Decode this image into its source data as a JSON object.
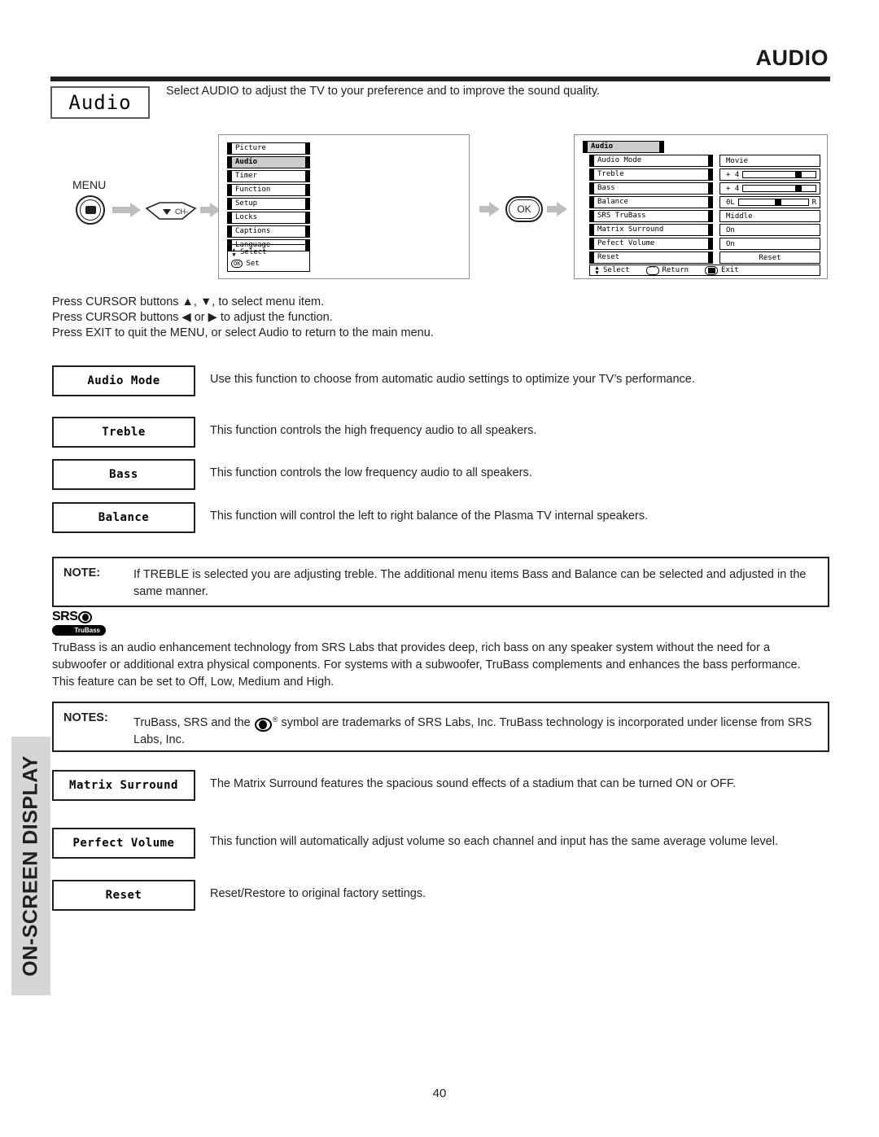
{
  "page": {
    "header_title": "AUDIO",
    "number": "40",
    "side_tab_label": "ON-SCREEN DISPLAY"
  },
  "intro": {
    "tag_label": "Audio",
    "description": "Select AUDIO to adjust the TV to your preference and to improve the sound quality."
  },
  "flow": {
    "menu_button_label": "MENU",
    "ch_button_label": "CH-",
    "ok_button_label": "OK"
  },
  "osd_main": {
    "items": [
      {
        "label": "Picture",
        "selected": false
      },
      {
        "label": "Audio",
        "selected": true
      },
      {
        "label": "Timer",
        "selected": false
      },
      {
        "label": "Function",
        "selected": false
      },
      {
        "label": "Setup",
        "selected": false
      },
      {
        "label": "Locks",
        "selected": false
      },
      {
        "label": "Captions",
        "selected": false
      },
      {
        "label": "Language",
        "selected": false
      }
    ],
    "hint_select": "Select",
    "hint_set": "Set",
    "hint_set_chip": "OK"
  },
  "osd_audio": {
    "title": "Audio",
    "rows": [
      {
        "label": "Audio Mode",
        "value": "Movie",
        "type": "text"
      },
      {
        "label": "Treble",
        "value": "+ 4",
        "type": "slider",
        "knob_percent": 72
      },
      {
        "label": "Bass",
        "value": "+ 4",
        "type": "slider",
        "knob_percent": 72
      },
      {
        "label": "Balance",
        "value": "0L",
        "type": "balance",
        "right_label": "R",
        "knob_percent": 52
      },
      {
        "label": "SRS TruBass",
        "value": "Middle",
        "type": "text"
      },
      {
        "label": "Matrix Surround",
        "value": "On",
        "type": "text"
      },
      {
        "label": "Pefect Volume",
        "value": "On",
        "type": "text"
      },
      {
        "label": "Reset",
        "value": "Reset",
        "type": "button"
      }
    ],
    "bottom_select": "Select",
    "bottom_return": "Return",
    "bottom_exit": "Exit"
  },
  "cursor_instructions": [
    "Press CURSOR buttons ▲, ▼, to select menu item.",
    "Press CURSOR buttons ◀ or ▶ to adjust the function.",
    "Press EXIT to quit the MENU, or select Audio to return to the main menu."
  ],
  "functions": [
    {
      "name": "Audio Mode",
      "description": "Use this function to choose from automatic audio settings to optimize your TV’s performance."
    },
    {
      "name": "Treble",
      "description": "This function controls the high frequency audio to all speakers."
    },
    {
      "name": "Bass",
      "description": "This function controls the low frequency audio to all speakers."
    },
    {
      "name": "Balance",
      "description": "This function will control the left to right balance of the Plasma TV internal speakers."
    },
    {
      "name": "Matrix Surround",
      "description": "The Matrix Surround features the spacious sound effects of a stadium that can be turned ON or OFF."
    },
    {
      "name": "Perfect Volume",
      "description": "This function will automatically adjust volume so each channel  and input has the same average volume level."
    },
    {
      "name": "Reset",
      "description": "Reset/Restore to original factory settings."
    }
  ],
  "note_treble": {
    "label": "NOTE:",
    "text": "If TREBLE is selected you are adjusting treble.  The additional menu items Bass and Balance can be selected and adjusted in the same manner."
  },
  "srs_logo": {
    "wordmark": "SRS",
    "subbrand": "TruBass"
  },
  "trubass_paragraph": "TruBass is an audio enhancement technology from SRS Labs that provides deep, rich bass on any speaker system without the need for a subwoofer or additional extra physical components.  For systems with a subwoofer, TruBass complements and enhances the bass performance.  This feature can be set to Off, Low, Medium and High.",
  "note_trademark": {
    "label": "NOTES:",
    "text_before": "TruBass, SRS and the",
    "text_after": "symbol are trademarks of SRS Labs, Inc.  TruBass technology is incorporated under license from SRS Labs, Inc.",
    "registered": "®"
  }
}
